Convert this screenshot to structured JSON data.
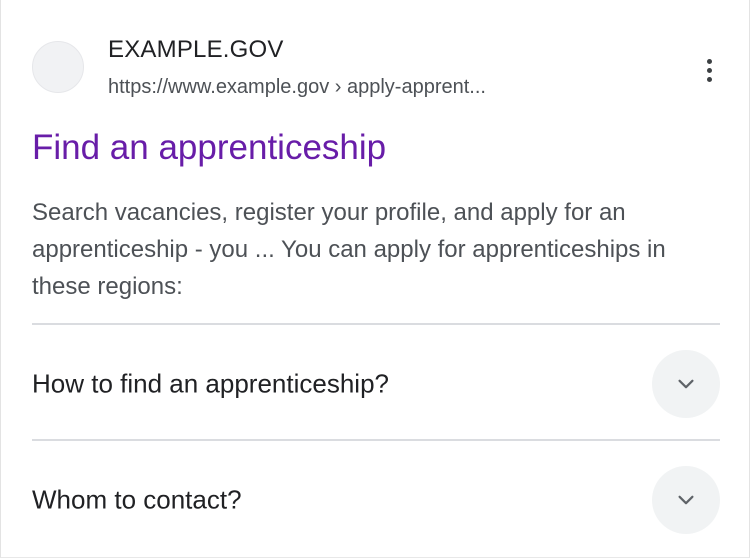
{
  "result": {
    "site_name": "EXAMPLE.GOV",
    "url": "https://www.example.gov › apply-apprent...",
    "more_icon": "more-vert-icon",
    "title": "Find an apprenticeship",
    "snippet": "Search vacancies, register your profile, and apply for an apprenticeship - you ... You can apply for apprenticeships in these regions:",
    "colors": {
      "title": "#681da8",
      "text": "#4d5156",
      "heading": "#202124"
    }
  },
  "faq": [
    {
      "question": "How to find an apprenticeship?",
      "icon": "chevron-down-icon"
    },
    {
      "question": "Whom to contact?",
      "icon": "chevron-down-icon"
    }
  ]
}
